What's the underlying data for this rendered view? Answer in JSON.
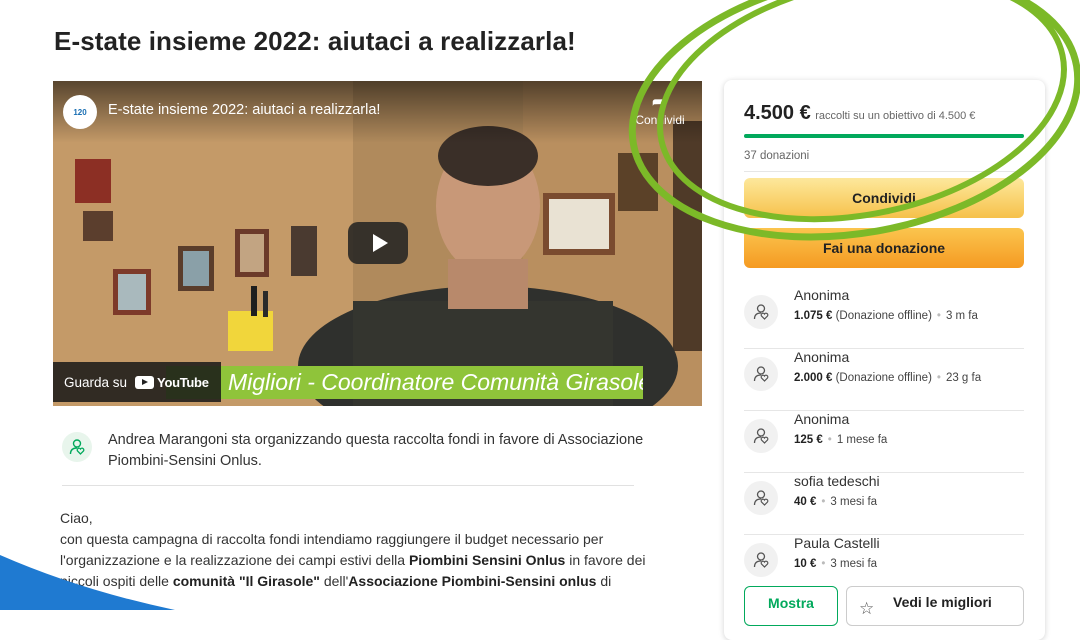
{
  "page_title": "E-state insieme 2022: aiutaci a realizzarla!",
  "video": {
    "title": "E-state insieme 2022: aiutaci a realizzarla!",
    "share_label": "Condividi",
    "caption": "Migliori - Coordinatore Comunità Girasole",
    "watch_on_label": "Guarda su",
    "youtube_label": "YouTube",
    "logo_text": "120"
  },
  "organizer_text": "Andrea Marangoni sta organizzando questa raccolta fondi in favore di Associazione Piombini-Sensini Onlus.",
  "story": {
    "greeting": "Ciao,",
    "p1_a": "con questa campagna di raccolta fondi intendiamo raggiungere il budget necessario per l'organizzazione e la realizzazione dei campi estivi della ",
    "p1_b": "Piombini Sensini Onlus",
    "p1_c": " in favore dei piccoli ospiti delle ",
    "p1_d": "comunità \"Il Girasole\"",
    "p1_e": " dell'",
    "p1_f": "Associazione Piombini-Sensini onlus",
    "p1_g": " di"
  },
  "campaign": {
    "raised": "4.500 €",
    "goal_text": "raccolti su un obiettivo di 4.500 €",
    "progress_fraction": 1.0,
    "donations_count": "37 donazioni",
    "share_label": "Condividi",
    "donate_label": "Fai una donazione"
  },
  "donors": [
    {
      "name": "Anonima",
      "amount": "1.075 €",
      "note": "(Donazione offline)",
      "time": "3 m fa"
    },
    {
      "name": "Anonima",
      "amount": "2.000 €",
      "note": "(Donazione offline)",
      "time": "23 g fa"
    },
    {
      "name": "Anonima",
      "amount": "125 €",
      "note": "",
      "time": "1 mese fa"
    },
    {
      "name": "sofia tedeschi",
      "amount": "40 €",
      "note": "",
      "time": "3 mesi fa"
    },
    {
      "name": "Paula Castelli",
      "amount": "10 €",
      "note": "",
      "time": "3 mesi fa"
    }
  ],
  "show_all_label": "Mostra",
  "best_label": "Vedi le migliori",
  "colors": {
    "accent_green": "#02a95c",
    "button_yellow": "#f6c14a",
    "button_orange": "#f59a22",
    "highlight_circle": "#7cb928",
    "caption_green": "#8fc43a",
    "corner_blue": "#1f7ad1"
  },
  "icons": [
    "play-icon",
    "share-icon",
    "youtube-icon",
    "person-heart-icon",
    "star-icon"
  ]
}
